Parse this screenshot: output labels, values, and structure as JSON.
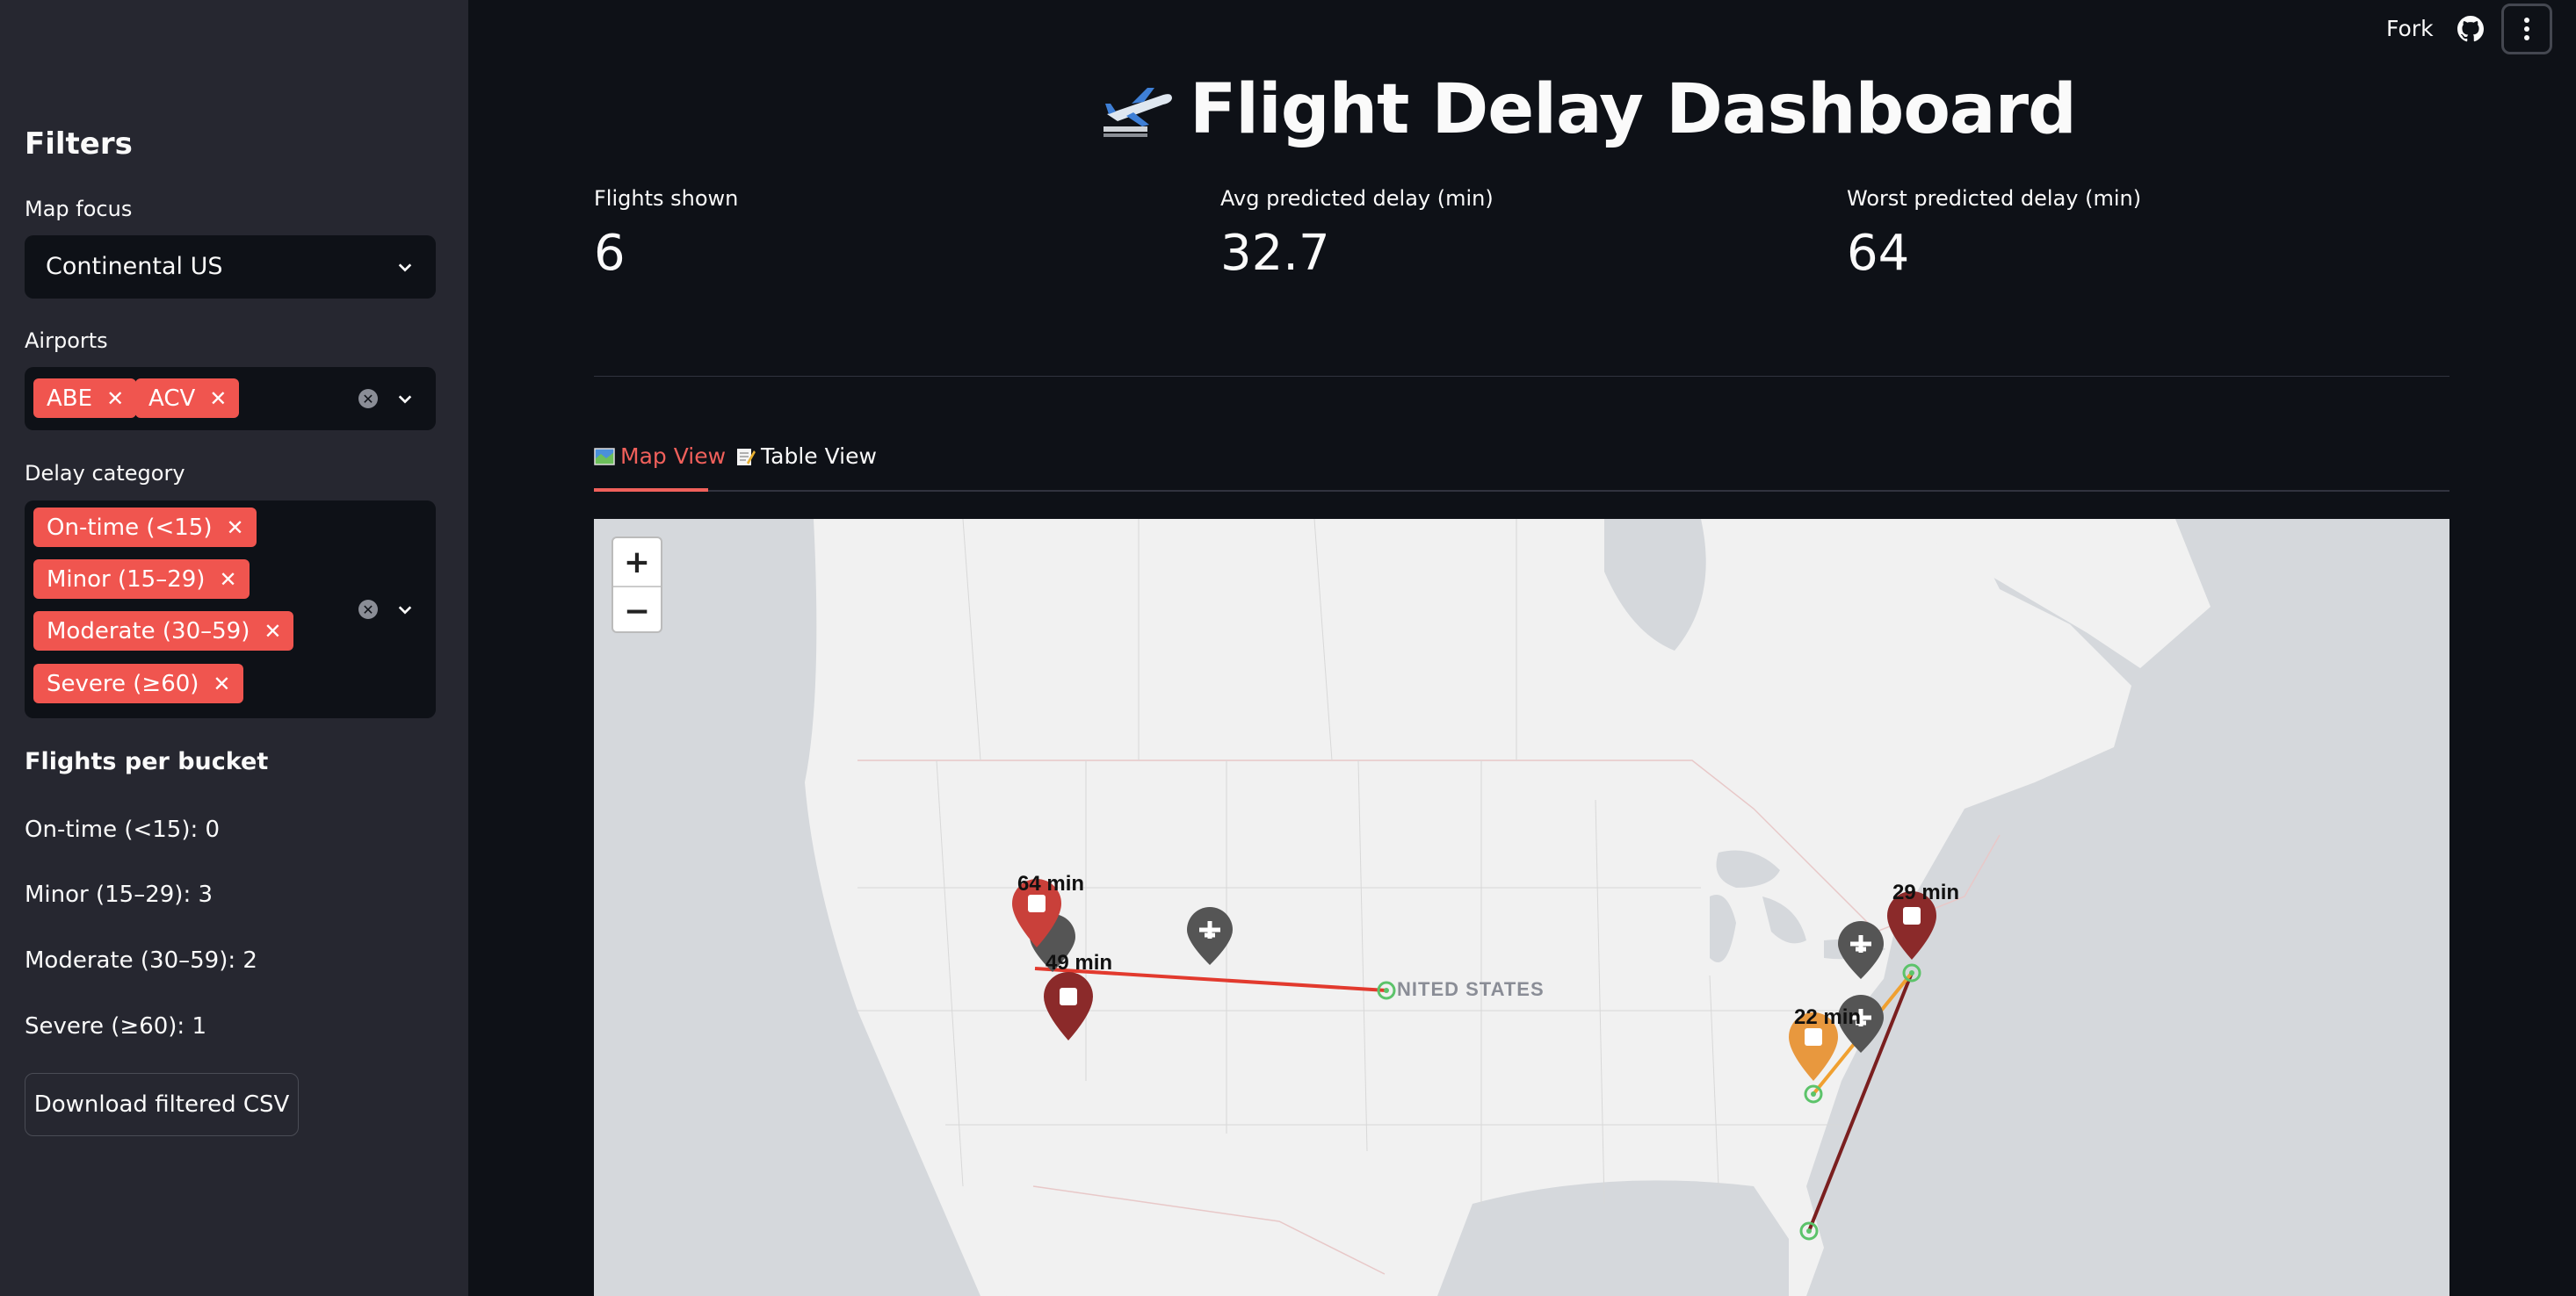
{
  "sidebar": {
    "title": "Filters",
    "map_focus": {
      "label": "Map focus",
      "value": "Continental US"
    },
    "airports": {
      "label": "Airports",
      "chips": [
        "ABE",
        "ACV"
      ]
    },
    "delay_category": {
      "label": "Delay category",
      "chips": [
        "On-time (<15)",
        "Minor (15–29)",
        "Moderate (30–59)",
        "Severe (≥60)"
      ]
    },
    "buckets": {
      "heading": "Flights per bucket",
      "items": [
        "On-time (<15): 0",
        "Minor (15–29): 3",
        "Moderate (30–59): 2",
        "Severe (≥60): 1"
      ]
    },
    "download_label": "Download filtered CSV"
  },
  "topbar": {
    "fork": "Fork"
  },
  "header": {
    "title": "Flight Delay Dashboard"
  },
  "metrics": [
    {
      "label": "Flights shown",
      "value": "6"
    },
    {
      "label": "Avg predicted delay (min)",
      "value": "32.7"
    },
    {
      "label": "Worst predicted delay (min)",
      "value": "64"
    }
  ],
  "tabs": [
    {
      "label": "Map View",
      "active": true
    },
    {
      "label": "Table View",
      "active": false
    }
  ],
  "map": {
    "zoom_in": "+",
    "zoom_out": "−",
    "country_label": "NITED STATES",
    "markers": [
      {
        "label": "64 min",
        "color": "#c9403a"
      },
      {
        "label": "49 min",
        "color": "#8b2a2a"
      },
      {
        "label": "29 min",
        "color": "#8b2a2a"
      },
      {
        "label": "22 min",
        "color": "#e8983e"
      }
    ],
    "colors": {
      "severe": "#e23a2e",
      "moderate": "#7a1f1f",
      "minor": "#f0a030",
      "airport": "#5cc36a",
      "plane": "#555555"
    }
  },
  "colors": {
    "accent": "#f0554f",
    "sidebar_bg": "#262730",
    "main_bg": "#0e1117"
  }
}
